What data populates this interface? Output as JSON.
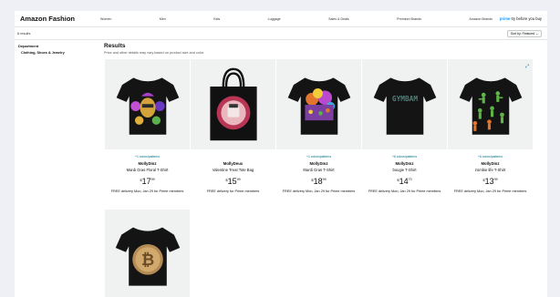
{
  "header": {
    "brand": "Amazon Fashion",
    "nav": [
      "Women",
      "Men",
      "Kids",
      "Luggage",
      "Sales & Deals",
      "Premium Brands",
      "Amazon Brands"
    ],
    "prime_word": "prime",
    "prime_rest": " try before you buy"
  },
  "subbar": {
    "results_count": "6 results",
    "sort_label": "Sort by: Featured",
    "sort_icon": "chevron-down-icon"
  },
  "sidebar": {
    "heading": "Department",
    "item": "Clothing, Shoes & Jewelry"
  },
  "results": {
    "title": "Results",
    "subtitle": "Price and other details may vary based on product size and color."
  },
  "products": [
    {
      "colors": "+1 colors/patterns",
      "brand": "MollyDmz",
      "title": "Mardi Gras Floral T-Shirt",
      "currency": "$",
      "whole": "17",
      "fraction": "99",
      "delivery": "FREE delivery Mon, Jan 29 for Prime members",
      "image": "tshirt-mask-icon"
    },
    {
      "colors": "",
      "brand": "MollyDeux",
      "title": "Valentine Treat Tote Bag",
      "currency": "$",
      "whole": "15",
      "fraction": "99",
      "delivery": "FREE delivery for Prime members",
      "image": "tote-bag-icon"
    },
    {
      "colors": "+1 colors/patterns",
      "brand": "MollyDmz",
      "title": "Mardi Gras T-Shirt",
      "currency": "$",
      "whole": "18",
      "fraction": "99",
      "delivery": "FREE delivery Mon, Jan 29 for Prime members",
      "image": "tshirt-parade-icon"
    },
    {
      "colors": "+6 colors/patterns",
      "brand": "MollyDmz",
      "title": "bougie T-Shirt",
      "currency": "$",
      "whole": "14",
      "fraction": "70",
      "delivery": "FREE delivery Mon, Jan 29 for Prime members",
      "image": "tshirt-gymbam-icon",
      "shirt_text": "GYMBAM"
    },
    {
      "colors": "+6 colors/patterns",
      "brand": "MollyDmz",
      "title": "zombie life T-Shirt",
      "currency": "$",
      "whole": "13",
      "fraction": "99",
      "delivery": "FREE delivery Mon, Jan 29 for Prime members",
      "image": "tshirt-zombies-icon"
    },
    {
      "colors": "",
      "brand": "",
      "title": "",
      "currency": "",
      "whole": "",
      "fraction": "",
      "delivery": "",
      "image": "tshirt-bitcoin-icon"
    }
  ],
  "colors": {
    "link": "#007185",
    "prime": "#1399ff",
    "card_bg": "#f0f2f2",
    "page_bg": "#eef0f5"
  }
}
